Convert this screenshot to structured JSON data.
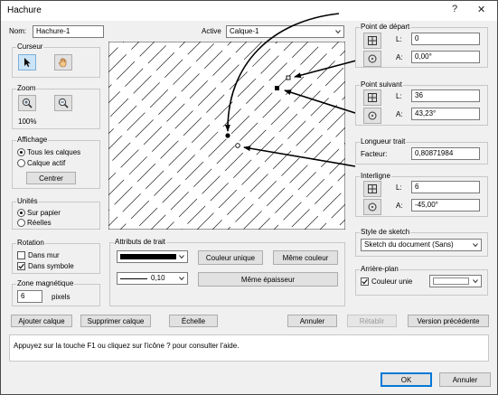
{
  "window": {
    "title": "Hachure",
    "help_glyph": "?",
    "close_glyph": "✕"
  },
  "top": {
    "name_label": "Nom:",
    "name_value": "Hachure-1",
    "active_label": "Active",
    "active_value": "Calque-1"
  },
  "cursor": {
    "title": "Curseur"
  },
  "zoom": {
    "title": "Zoom",
    "percent": "100%"
  },
  "display": {
    "title": "Affichage",
    "opt1": "Tous les calques",
    "opt2": "Calque actif",
    "center_btn": "Centrer"
  },
  "units": {
    "title": "Unités",
    "opt1": "Sur papier",
    "opt2": "Réelles"
  },
  "rotation": {
    "title": "Rotation",
    "opt1": "Dans mur",
    "opt2": "Dans symbole"
  },
  "magnetic": {
    "title": "Zone magnétique",
    "value": "6",
    "unit": "pixels"
  },
  "line_attrs": {
    "title": "Attributs de trait",
    "weight": "0,10",
    "unique_color_btn": "Couleur unique",
    "same_color_btn": "Même couleur",
    "same_thickness_btn": "Même épaisseur"
  },
  "start_point": {
    "title": "Point de départ",
    "l_label": "L:",
    "l_value": "0",
    "a_label": "A:",
    "a_value": "0,00°"
  },
  "next_point": {
    "title": "Point suivant",
    "l_label": "L:",
    "l_value": "36",
    "a_label": "A:",
    "a_value": "43,23°"
  },
  "dash_length": {
    "title": "Longueur trait",
    "factor_label": "Facteur:",
    "factor_value": "0,80871984"
  },
  "spacing": {
    "title": "Interligne",
    "l_label": "L:",
    "l_value": "6",
    "a_label": "A:",
    "a_value": "-45,00°"
  },
  "sketch": {
    "title": "Style de sketch",
    "value": "Sketch du document (Sans)"
  },
  "background": {
    "title": "Arrière-plan",
    "checkbox_label": "Couleur unie"
  },
  "actions": {
    "add_layer": "Ajouter calque",
    "delete_layer": "Supprimer calque",
    "scale": "Échelle",
    "cancel": "Annuler",
    "restore": "Rétablir",
    "prev_version": "Version précédente"
  },
  "help_text": "Appuyez sur la touche F1 ou cliquez sur l'icône ? pour consulter l'aide.",
  "footer": {
    "ok": "OK",
    "cancel": "Annuler"
  },
  "colors": {
    "accent": "#0078d7",
    "dialog_bg": "#f0f0f0"
  }
}
